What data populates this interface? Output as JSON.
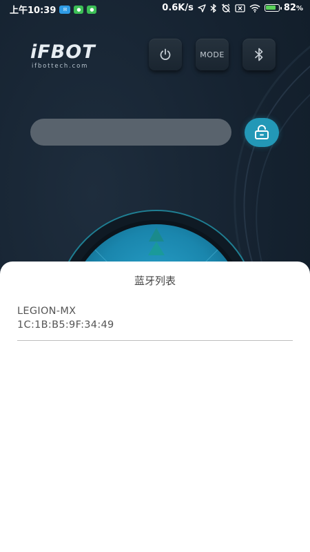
{
  "status_bar": {
    "time": "上午10:39",
    "speed": "0.6K/s",
    "battery_percent": "82",
    "battery_unit": "%",
    "battery_level": 0.82,
    "notification_icons": [
      "app-badge-icon",
      "wechat-icon",
      "wechat-icon"
    ],
    "system_icons": [
      "location-icon",
      "bluetooth-icon",
      "alarm-off-icon",
      "sim-blocked-icon",
      "wifi-icon",
      "battery-charging-icon"
    ]
  },
  "logo": {
    "text": "iFBOT",
    "domain": "ifbottech.com"
  },
  "toolbar": {
    "power_icon": "power-icon",
    "mode_label": "MODE",
    "bluetooth_icon": "bluetooth-icon"
  },
  "control": {
    "input_value": "",
    "lock_icon": "unlock-icon"
  },
  "joystick": {
    "up_icon": "double-chevron-up-icon"
  },
  "bluetooth_sheet": {
    "title": "蓝牙列表",
    "devices": [
      {
        "name": "LEGION-MX",
        "mac": "1C:1B:B5:9F:34:49"
      }
    ]
  },
  "colors": {
    "background": "#172431",
    "accent": "#2398b7",
    "input_bar": "#59636d",
    "sheet_background": "#ffffff",
    "sheet_text": "#555555"
  }
}
